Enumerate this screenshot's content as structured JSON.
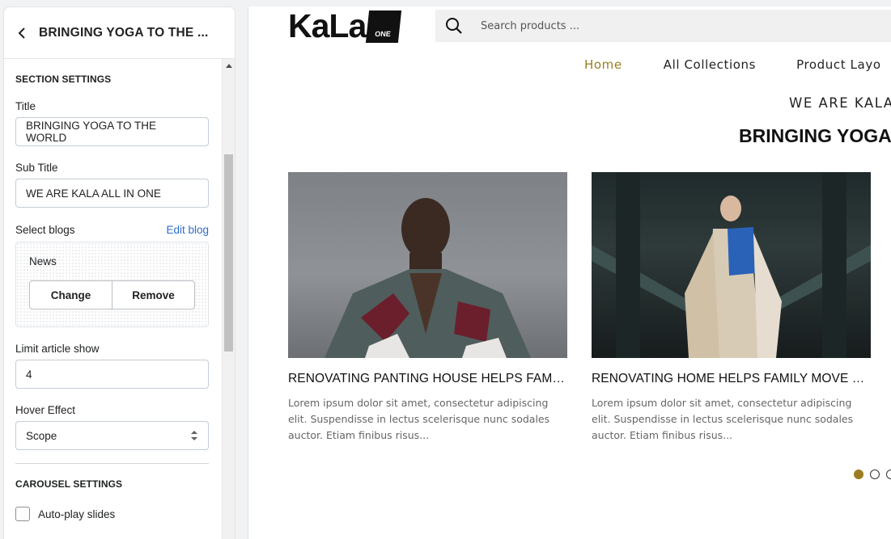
{
  "panel": {
    "title": "BRINGING YOGA TO THE ...",
    "section_heading": "SECTION SETTINGS",
    "title_label": "Title",
    "title_value": "BRINGING YOGA TO THE WORLD",
    "subtitle_label": "Sub Title",
    "subtitle_value": "WE ARE KALA ALL IN ONE",
    "select_blogs_label": "Select blogs",
    "edit_blog_link": "Edit blog",
    "blog_name": "News",
    "change_button": "Change",
    "remove_button": "Remove",
    "limit_label": "Limit article show",
    "limit_value": "4",
    "hover_label": "Hover Effect",
    "hover_value": "Scope",
    "carousel_heading": "CAROUSEL SETTINGS",
    "autoplay_label": "Auto-play slides"
  },
  "preview": {
    "logo_text": "KaLa",
    "logo_badge": "ONE",
    "search_placeholder": "Search products ...",
    "nav": [
      "Home",
      "All Collections",
      "Product Layo"
    ],
    "eyebrow": "WE ARE KALA",
    "headline": "BRINGING YOGA T",
    "cards": [
      {
        "title": "RENOVATING PANTING HOUSE HELPS FAMILY MOVE ON",
        "excerpt": "Lorem ipsum dolor sit amet, consectetur adipiscing elit. Suspendisse in lectus scelerisque nunc sodales auctor. Etiam finibus risus..."
      },
      {
        "title": "RENOVATING HOME HELPS FAMILY MOVE ON FROM",
        "excerpt": "Lorem ipsum dolor sit amet, consectetur adipiscing elit. Suspendisse in lectus scelerisque nunc sodales auctor. Etiam finibus risus..."
      }
    ]
  },
  "colors": {
    "accent": "#9b7d20",
    "link": "#2c6ecb"
  },
  "icons": [
    "chevron-left-icon",
    "search-icon",
    "select-arrows-icon"
  ]
}
